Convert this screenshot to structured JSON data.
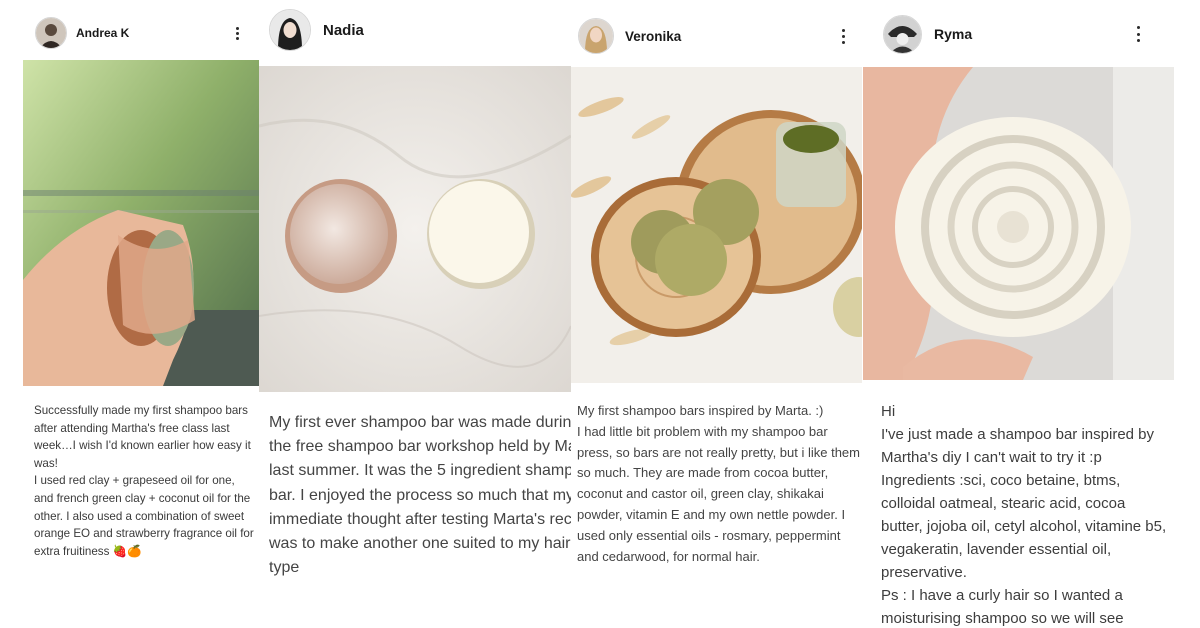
{
  "cards": [
    {
      "author": "Andrea K",
      "image": "photo of a two-tone red and green clay shampoo bar held in a hand",
      "caption": "Successfully made my first shampoo bars after attending Martha's free class last week…I wish I'd known earlier how easy it was!\nI used red clay + grapeseed oil for one, and french green clay + coconut oil for the other. I also used a combination of sweet orange EO and strawberry fragrance oil for extra fruitiness 🍓🍊"
    },
    {
      "author": "Nadia",
      "image": "photo of two round shampoo bars, one lathered, on a marble surface",
      "caption": "My first ever shampoo bar was made during the free shampoo bar workshop held by Marta last summer. It was the 5 ingredient shampoo bar. I enjoyed the process so much that my immediate thought after testing Marta's recipe was to make another one suited to my hair type"
    },
    {
      "author": "Veronika",
      "image": "photo of green shampoo bars on wooden slices with a jar of powder",
      "caption": "My first shampoo bars inspired by Marta. :)\nI had little bit problem with my shampoo bar press, so bars are not really pretty, but i like them so much. They are made from cocoa butter, coconut and castor oil, green clay, shikakai powder, vitamin E and my own nettle powder. I used only essential oils - rosmary, peppermint and cedarwood, for normal hair."
    },
    {
      "author": "Ryma",
      "image": "photo of a white rose-shaped shampoo bar held in a hand",
      "caption": "Hi\nI've just made a shampoo bar inspired by Martha's diy I can't wait to try it :p\nIngredients :sci, coco betaine, btms, colloidal oatmeal, stearic acid, cocoa butter, jojoba oil, cetyl alcohol, vitamine b5, vegakeratin, lavender essential oil, preservative.\nPs : I have a curly hair so I wanted a moisturising shampoo so we will see"
    }
  ],
  "icons": {
    "menu": "kebab-menu-icon"
  }
}
